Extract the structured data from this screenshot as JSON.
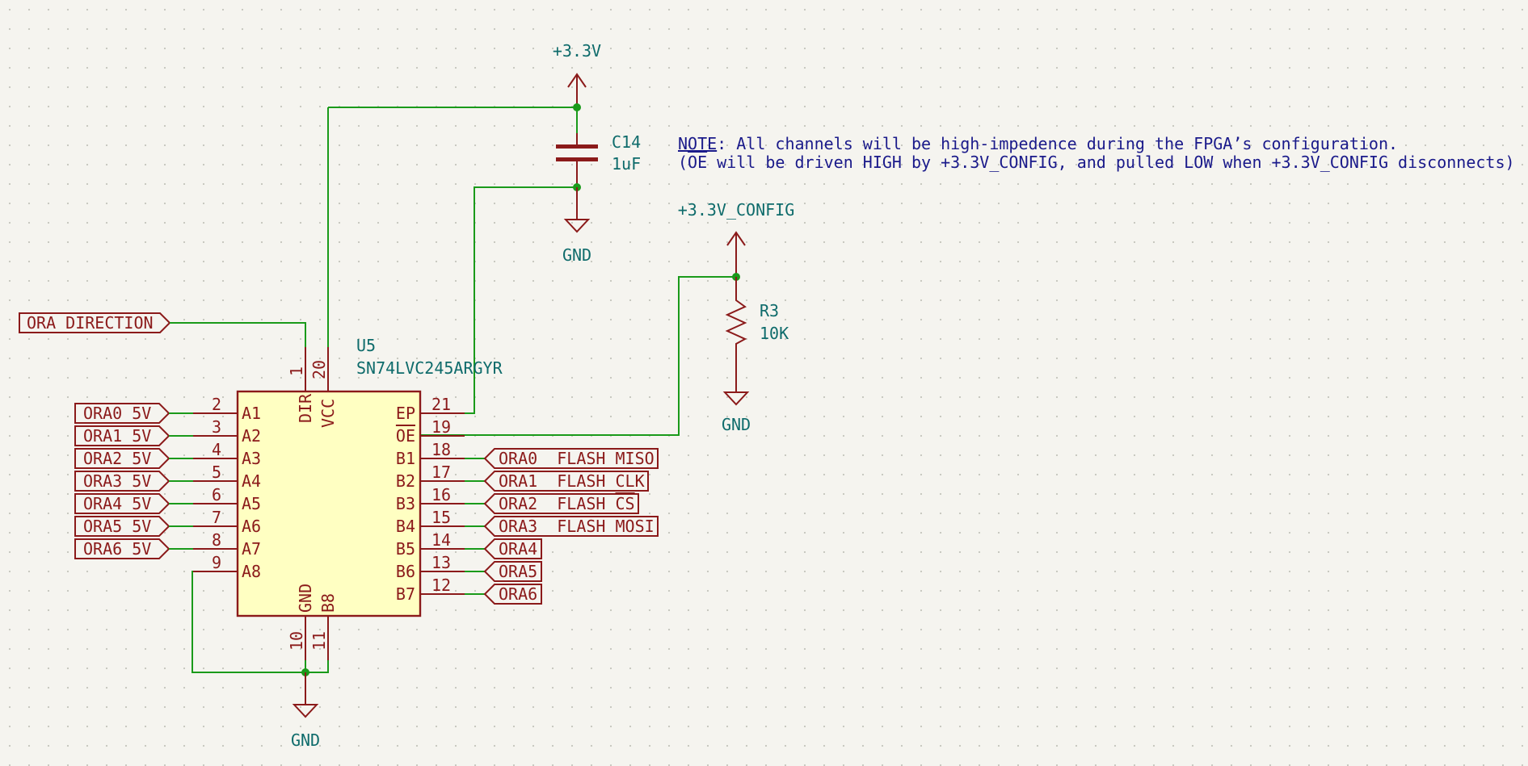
{
  "power": {
    "vcc_top": "+3.3V",
    "vcc_config": "+3.3V_CONFIG",
    "gnd_cap": "GND",
    "gnd_res": "GND",
    "gnd_ic": "GND"
  },
  "cap": {
    "ref": "C14",
    "value": "1uF"
  },
  "res": {
    "ref": "R3",
    "value": "10K"
  },
  "ic": {
    "ref": "U5",
    "value": "SN74LVC245ARGYR",
    "top_pins": [
      {
        "num": "1",
        "name": "DIR"
      },
      {
        "num": "20",
        "name": "VCC"
      }
    ],
    "bottom_pins": [
      {
        "num": "10",
        "name": "GND"
      },
      {
        "num": "11",
        "name": "B8"
      }
    ],
    "left_pins": [
      {
        "num": "2",
        "name": "A1"
      },
      {
        "num": "3",
        "name": "A2"
      },
      {
        "num": "4",
        "name": "A3"
      },
      {
        "num": "5",
        "name": "A4"
      },
      {
        "num": "6",
        "name": "A5"
      },
      {
        "num": "7",
        "name": "A6"
      },
      {
        "num": "8",
        "name": "A7"
      },
      {
        "num": "9",
        "name": "A8"
      }
    ],
    "right_pins": [
      {
        "num": "21",
        "name": "EP"
      },
      {
        "num": "19",
        "name": "OE"
      },
      {
        "num": "18",
        "name": "B1"
      },
      {
        "num": "17",
        "name": "B2"
      },
      {
        "num": "16",
        "name": "B3"
      },
      {
        "num": "15",
        "name": "B4"
      },
      {
        "num": "14",
        "name": "B5"
      },
      {
        "num": "13",
        "name": "B6"
      },
      {
        "num": "12",
        "name": "B7"
      }
    ]
  },
  "labels": {
    "direction": "ORA_DIRECTION",
    "left": [
      "ORA0_5V",
      "ORA1_5V",
      "ORA2_5V",
      "ORA3_5V",
      "ORA4_5V",
      "ORA5_5V",
      "ORA6_5V"
    ],
    "right": [
      "ORA0__FLASH_MISO",
      "ORA1__FLASH_CLK",
      "ORA2__FLASH_CS",
      "ORA3__FLASH_MOSI",
      "ORA4",
      "ORA5",
      "ORA6"
    ]
  },
  "note": {
    "prefix": "NOTE",
    "line1_rest": ": All channels will be high-impedence during the FPGA’s configuration.",
    "line2_open": "(",
    "line2_oe": "OE",
    "line2_rest": " will be driven HIGH by +3.3V_CONFIG, and pulled LOW when +3.3V_CONFIG disconnects)"
  },
  "colors": {
    "background": "#f5f4ef",
    "grid_dot": "#c4c4bc",
    "wire": "#1a9a1a",
    "component": "#8b1a1a",
    "ic_fill": "#ffffc2",
    "power_text": "#0e6b6b",
    "note_text": "#1a1a8a"
  }
}
